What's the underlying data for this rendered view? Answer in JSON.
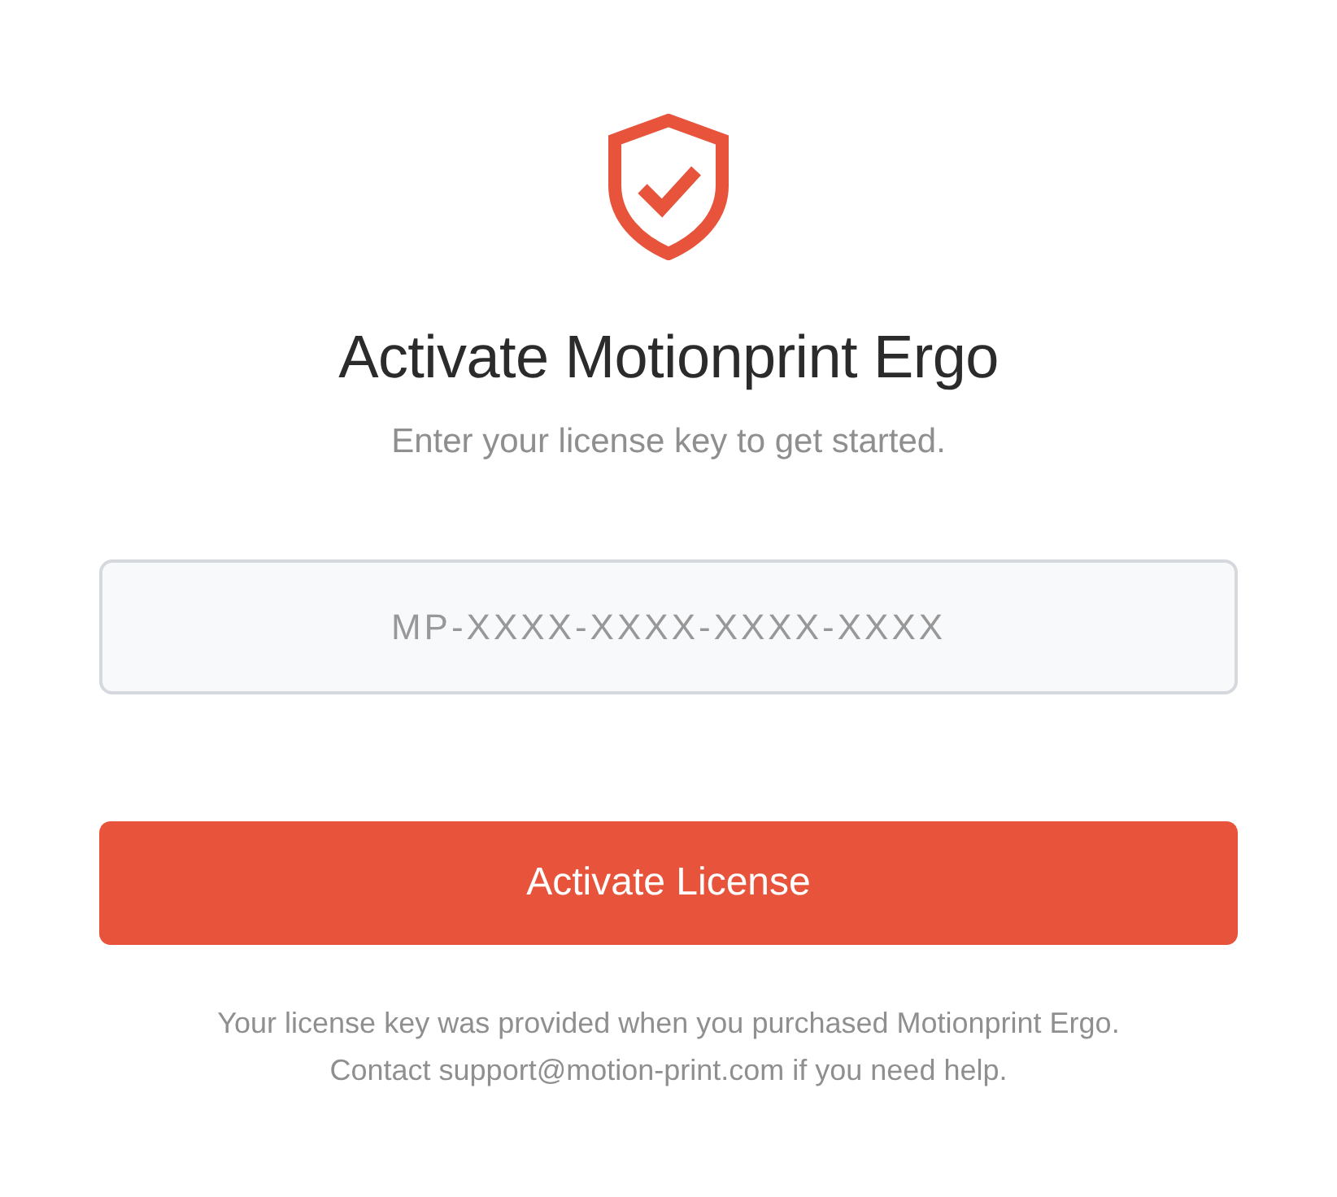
{
  "title": "Activate Motionprint Ergo",
  "subtitle": "Enter your license key to get started.",
  "license_field": {
    "placeholder": "MP-XXXX-XXXX-XXXX-XXXX"
  },
  "button": {
    "label": "Activate License"
  },
  "footer": [
    "Your license key was provided when you purchased Motionprint Ergo.",
    "Contact support@motion-print.com if you need help."
  ]
}
